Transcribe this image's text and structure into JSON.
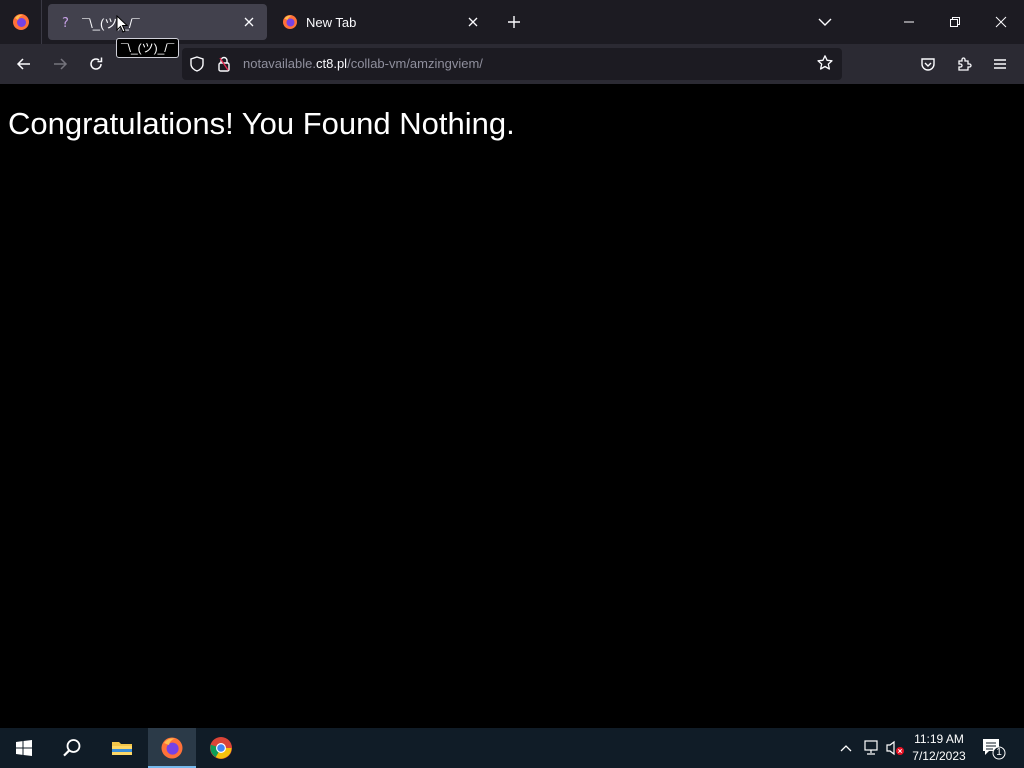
{
  "browser": {
    "tabs": [
      {
        "title": "¯\\_(ツ)_/¯",
        "favicon": "generic-page-icon",
        "active": true
      },
      {
        "title": "New Tab",
        "favicon": "firefox-icon",
        "active": false
      }
    ],
    "tooltip": "¯\\_(ツ)_/¯",
    "url": {
      "prefix": "notavailable.",
      "host": "ct8.pl",
      "path": "/collab-vm/amzingviem/"
    }
  },
  "page": {
    "heading": "Congratulations! You Found Nothing."
  },
  "taskbar": {
    "apps": [
      "windows-start-icon",
      "search-icon",
      "file-explorer-icon",
      "firefox-icon",
      "chrome-icon"
    ],
    "clock_time": "11:19 AM",
    "clock_date": "7/12/2023",
    "notification_count": "1"
  },
  "colors": {
    "tab_strip": "#1c1b22",
    "active_tab": "#42414d",
    "nav_bar": "#2b2a33",
    "page_background": "#000000",
    "taskbar": "#101c27"
  }
}
